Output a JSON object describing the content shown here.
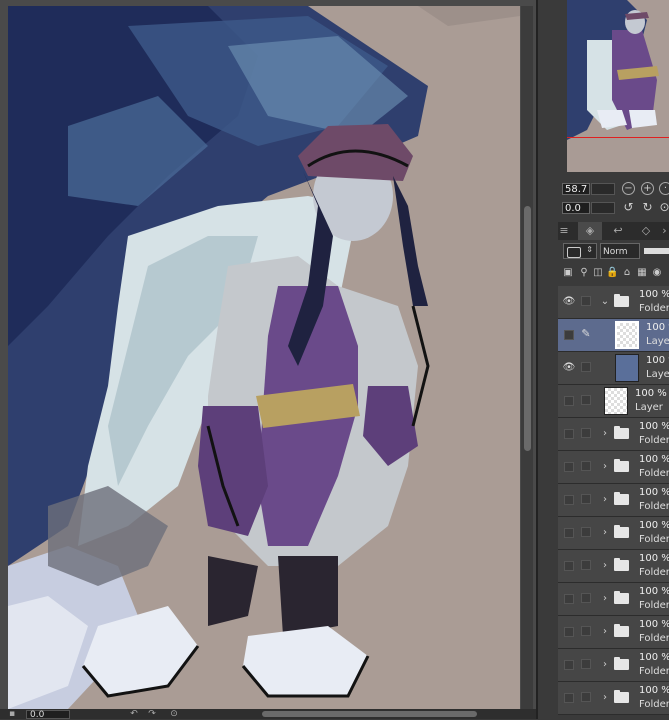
{
  "canvas": {
    "zoom_value": "0.0",
    "artwork_description_icon": "illustration"
  },
  "navigator": {
    "zoom_value": "58.7",
    "rotation_value": "0.0"
  },
  "layer_panel": {
    "blend_mode": "Norm",
    "layers": [
      {
        "opacity": "100 %",
        "name": "Folder",
        "type": "folder",
        "expanded": true,
        "visible": true,
        "selected": false,
        "indent": 0
      },
      {
        "opacity": "100 %",
        "name": "Layer",
        "type": "layer",
        "visible": false,
        "selected": true,
        "indent": 1,
        "editing": true
      },
      {
        "opacity": "100 %",
        "name": "Layer",
        "type": "layer",
        "visible": true,
        "selected": false,
        "indent": 1,
        "art": true
      },
      {
        "opacity": "100 %",
        "name": "Layer",
        "type": "layer",
        "visible": false,
        "selected": false,
        "indent": 0
      },
      {
        "opacity": "100 %",
        "name": "Folder",
        "type": "folder",
        "expanded": false,
        "visible": false,
        "selected": false,
        "indent": 0
      },
      {
        "opacity": "100 %",
        "name": "Folder",
        "type": "folder",
        "expanded": false,
        "visible": false,
        "selected": false,
        "indent": 0
      },
      {
        "opacity": "100 %",
        "name": "Folder",
        "type": "folder",
        "expanded": false,
        "visible": false,
        "selected": false,
        "indent": 0
      },
      {
        "opacity": "100 %",
        "name": "Folder",
        "type": "folder",
        "expanded": false,
        "visible": false,
        "selected": false,
        "indent": 0
      },
      {
        "opacity": "100 %",
        "name": "Folder",
        "type": "folder",
        "expanded": false,
        "visible": false,
        "selected": false,
        "indent": 0
      },
      {
        "opacity": "100 %",
        "name": "Folder",
        "type": "folder",
        "expanded": false,
        "visible": false,
        "selected": false,
        "indent": 0
      },
      {
        "opacity": "100 %",
        "name": "Folder",
        "type": "folder",
        "expanded": false,
        "visible": false,
        "selected": false,
        "indent": 0
      },
      {
        "opacity": "100 %",
        "name": "Folder",
        "type": "folder",
        "expanded": false,
        "visible": false,
        "selected": false,
        "indent": 0
      },
      {
        "opacity": "100 %",
        "name": "Folder",
        "type": "folder",
        "expanded": false,
        "visible": false,
        "selected": false,
        "indent": 0
      }
    ]
  },
  "colors": {
    "canvas_bg": "#aa9c95",
    "selection": "#5d6b8e",
    "nav_line": "#e02020"
  }
}
